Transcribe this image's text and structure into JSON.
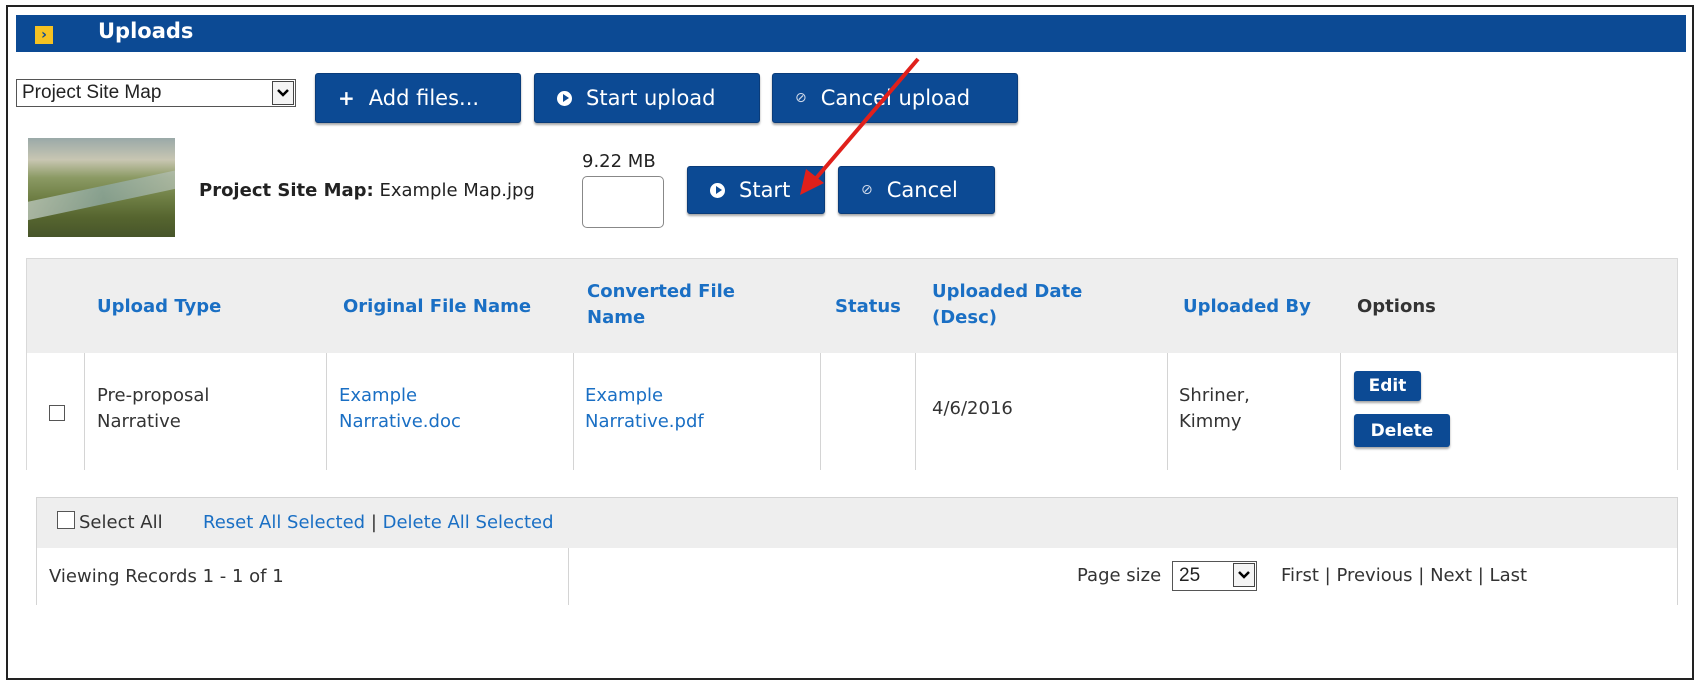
{
  "panel": {
    "title": "Uploads",
    "title_icon": "chevron-right-icon"
  },
  "toolbar": {
    "upload_type_selected": "Project Site Map",
    "add_files_label": "Add files...",
    "start_upload_label": "Start upload",
    "cancel_upload_label": "Cancel upload"
  },
  "pending_file": {
    "type_label": "Project Site Map:",
    "file_name": "Example Map.jpg",
    "size": "9.22 MB",
    "progress": 0,
    "start_label": "Start",
    "cancel_label": "Cancel"
  },
  "table": {
    "columns": [
      {
        "label": "Upload Type"
      },
      {
        "label": "Original File Name"
      },
      {
        "label": "Converted File Name"
      },
      {
        "label": "Status"
      },
      {
        "label": "Uploaded Date (Desc)"
      },
      {
        "label": "Uploaded By"
      },
      {
        "label": "Options"
      }
    ],
    "rows": [
      {
        "upload_type": "Pre-proposal Narrative",
        "original_file": "Example Narrative.doc",
        "converted_file": "Example Narrative.pdf",
        "status": "",
        "uploaded_date": "4/6/2016",
        "uploaded_by": "Shriner, Kimmy",
        "edit_label": "Edit",
        "delete_label": "Delete"
      }
    ]
  },
  "footer": {
    "select_all_label": "Select All",
    "reset_all_label": "Reset All Selected",
    "delete_all_label": "Delete All Selected",
    "separator": "|",
    "viewing_records": "Viewing Records 1 - 1 of 1",
    "page_size_label": "Page size",
    "page_size_value": "25",
    "pager": [
      "First",
      "Previous",
      "Next",
      "Last"
    ]
  },
  "colors": {
    "primary": "#0c4a94",
    "link": "#1a6fc4",
    "annotation_arrow": "#e0201b"
  }
}
